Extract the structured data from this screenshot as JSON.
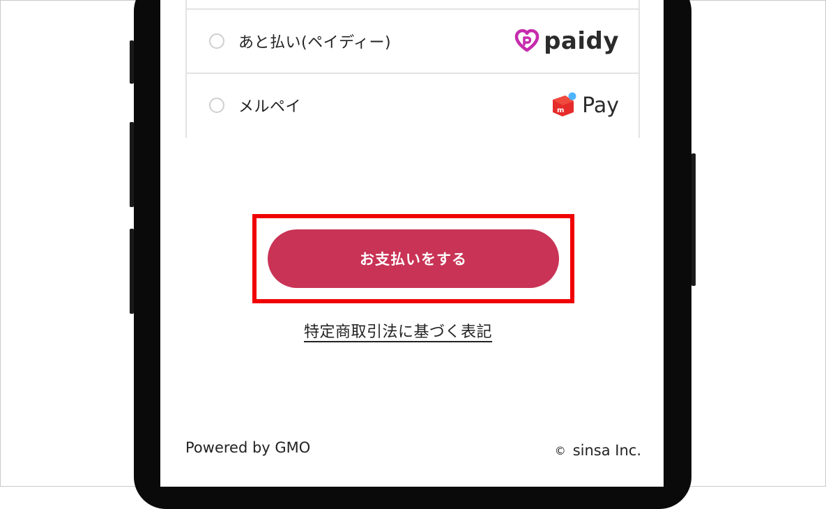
{
  "payment_options": [
    {
      "label": "あと払い(ペイディー)",
      "logo_text": "paidy",
      "logo_icon": "paidy-heart-icon",
      "selected": false
    },
    {
      "label": "メルペイ",
      "logo_text": "Pay",
      "logo_icon": "merpay-box-icon",
      "selected": false
    }
  ],
  "pay_button": {
    "label": "お支払いをする"
  },
  "legal_link": {
    "label": "特定商取引法に基づく表記"
  },
  "footer": {
    "powered_by": "Powered by GMO",
    "copyright_symbol": "©",
    "copyright_text": "sinsa Inc."
  },
  "colors": {
    "accent": "#c93355",
    "highlight_border": "#f00000",
    "paidy_brand": "#c62bad",
    "merpay_red": "#e62b2b",
    "merpay_blue": "#4fb4ff"
  }
}
